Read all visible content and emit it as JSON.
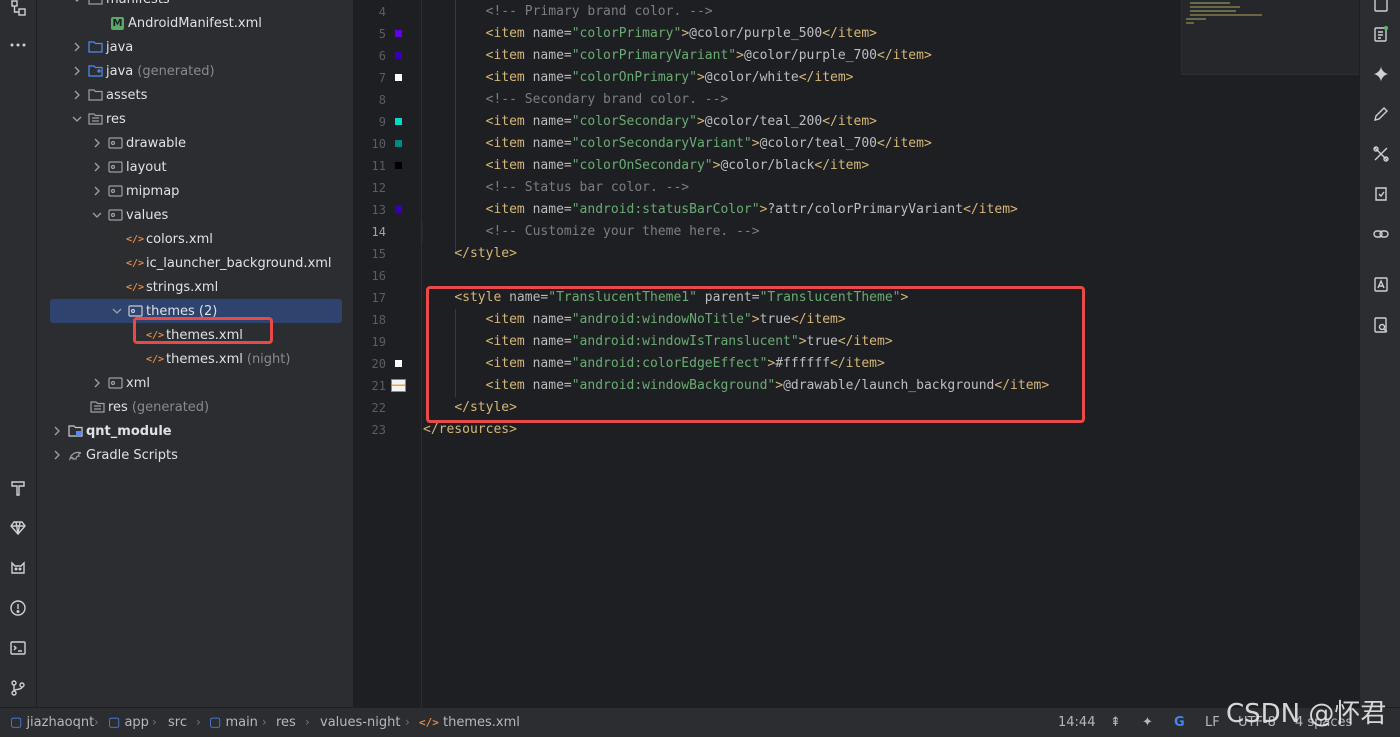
{
  "project_tree": {
    "items": [
      {
        "label": "manifests",
        "hint": ""
      },
      {
        "label": "AndroidManifest.xml",
        "hint": ""
      },
      {
        "label": "java",
        "hint": ""
      },
      {
        "label": "java",
        "hint": "(generated)"
      },
      {
        "label": "assets",
        "hint": ""
      },
      {
        "label": "res",
        "hint": ""
      },
      {
        "label": "drawable",
        "hint": ""
      },
      {
        "label": "layout",
        "hint": ""
      },
      {
        "label": "mipmap",
        "hint": ""
      },
      {
        "label": "values",
        "hint": ""
      },
      {
        "label": "colors.xml",
        "hint": ""
      },
      {
        "label": "ic_launcher_background.xml",
        "hint": ""
      },
      {
        "label": "strings.xml",
        "hint": ""
      },
      {
        "label": "themes (2)",
        "hint": ""
      },
      {
        "label": "themes.xml",
        "hint": ""
      },
      {
        "label": "themes.xml",
        "hint": "(night)"
      },
      {
        "label": "xml",
        "hint": ""
      },
      {
        "label": "res",
        "hint": "(generated)"
      },
      {
        "label": "qnt_module",
        "hint": ""
      },
      {
        "label": "Gradle Scripts",
        "hint": ""
      }
    ]
  },
  "editor": {
    "current_line": "14",
    "lines": [
      {
        "n": "4",
        "indent": "        ",
        "parts": [
          {
            "t": "com",
            "s": "<!-- Primary brand color. -->"
          }
        ]
      },
      {
        "n": "5",
        "indent": "        ",
        "parts": [
          {
            "t": "tag",
            "s": "<item "
          },
          {
            "t": "attr",
            "s": "name="
          },
          {
            "t": "val",
            "s": "\"colorPrimary\""
          },
          {
            "t": "tag",
            "s": ">"
          },
          {
            "t": "txt",
            "s": "@color/purple_500"
          },
          {
            "t": "tag",
            "s": "</item>"
          }
        ]
      },
      {
        "n": "6",
        "indent": "        ",
        "parts": [
          {
            "t": "tag",
            "s": "<item "
          },
          {
            "t": "attr",
            "s": "name="
          },
          {
            "t": "val",
            "s": "\"colorPrimaryVariant\""
          },
          {
            "t": "tag",
            "s": ">"
          },
          {
            "t": "txt",
            "s": "@color/purple_700"
          },
          {
            "t": "tag",
            "s": "</item>"
          }
        ]
      },
      {
        "n": "7",
        "indent": "        ",
        "parts": [
          {
            "t": "tag",
            "s": "<item "
          },
          {
            "t": "attr",
            "s": "name="
          },
          {
            "t": "val",
            "s": "\"colorOnPrimary\""
          },
          {
            "t": "tag",
            "s": ">"
          },
          {
            "t": "txt",
            "s": "@color/white"
          },
          {
            "t": "tag",
            "s": "</item>"
          }
        ]
      },
      {
        "n": "8",
        "indent": "        ",
        "parts": [
          {
            "t": "com",
            "s": "<!-- Secondary brand color. -->"
          }
        ]
      },
      {
        "n": "9",
        "indent": "        ",
        "parts": [
          {
            "t": "tag",
            "s": "<item "
          },
          {
            "t": "attr",
            "s": "name="
          },
          {
            "t": "val",
            "s": "\"colorSecondary\""
          },
          {
            "t": "tag",
            "s": ">"
          },
          {
            "t": "txt",
            "s": "@color/teal_200"
          },
          {
            "t": "tag",
            "s": "</item>"
          }
        ]
      },
      {
        "n": "10",
        "indent": "        ",
        "parts": [
          {
            "t": "tag",
            "s": "<item "
          },
          {
            "t": "attr",
            "s": "name="
          },
          {
            "t": "val",
            "s": "\"colorSecondaryVariant\""
          },
          {
            "t": "tag",
            "s": ">"
          },
          {
            "t": "txt",
            "s": "@color/teal_700"
          },
          {
            "t": "tag",
            "s": "</item>"
          }
        ]
      },
      {
        "n": "11",
        "indent": "        ",
        "parts": [
          {
            "t": "tag",
            "s": "<item "
          },
          {
            "t": "attr",
            "s": "name="
          },
          {
            "t": "val",
            "s": "\"colorOnSecondary\""
          },
          {
            "t": "tag",
            "s": ">"
          },
          {
            "t": "txt",
            "s": "@color/black"
          },
          {
            "t": "tag",
            "s": "</item>"
          }
        ]
      },
      {
        "n": "12",
        "indent": "        ",
        "parts": [
          {
            "t": "com",
            "s": "<!-- Status bar color. -->"
          }
        ]
      },
      {
        "n": "13",
        "indent": "        ",
        "parts": [
          {
            "t": "tag",
            "s": "<item "
          },
          {
            "t": "attr",
            "s": "name="
          },
          {
            "t": "val",
            "s": "\"android:statusBarColor\""
          },
          {
            "t": "tag",
            "s": ">"
          },
          {
            "t": "txt",
            "s": "?attr/colorPrimaryVariant"
          },
          {
            "t": "tag",
            "s": "</item>"
          }
        ]
      },
      {
        "n": "14",
        "indent": "        ",
        "parts": [
          {
            "t": "com",
            "s": "<!-- Customize your theme here. -->"
          }
        ]
      },
      {
        "n": "15",
        "indent": "    ",
        "parts": [
          {
            "t": "tag",
            "s": "</style>"
          }
        ]
      },
      {
        "n": "16",
        "indent": "",
        "parts": []
      },
      {
        "n": "17",
        "indent": "    ",
        "parts": [
          {
            "t": "tag",
            "s": "<style "
          },
          {
            "t": "attr",
            "s": "name="
          },
          {
            "t": "val",
            "s": "\"TranslucentTheme1\""
          },
          {
            "t": "attr",
            "s": " parent="
          },
          {
            "t": "val",
            "s": "\"TranslucentTheme\""
          },
          {
            "t": "tag",
            "s": ">"
          }
        ]
      },
      {
        "n": "18",
        "indent": "        ",
        "parts": [
          {
            "t": "tag",
            "s": "<item "
          },
          {
            "t": "attr",
            "s": "name="
          },
          {
            "t": "val",
            "s": "\"android:windowNoTitle\""
          },
          {
            "t": "tag",
            "s": ">"
          },
          {
            "t": "txt",
            "s": "true"
          },
          {
            "t": "tag",
            "s": "</item>"
          }
        ]
      },
      {
        "n": "19",
        "indent": "        ",
        "parts": [
          {
            "t": "tag",
            "s": "<item "
          },
          {
            "t": "attr",
            "s": "name="
          },
          {
            "t": "val",
            "s": "\"android:windowIsTranslucent\""
          },
          {
            "t": "tag",
            "s": ">"
          },
          {
            "t": "txt",
            "s": "true"
          },
          {
            "t": "tag",
            "s": "</item>"
          }
        ]
      },
      {
        "n": "20",
        "indent": "        ",
        "parts": [
          {
            "t": "tag",
            "s": "<item "
          },
          {
            "t": "attr",
            "s": "name="
          },
          {
            "t": "val",
            "s": "\"android:colorEdgeEffect\""
          },
          {
            "t": "tag",
            "s": ">"
          },
          {
            "t": "txt",
            "s": "#ffffff"
          },
          {
            "t": "tag",
            "s": "</item>"
          }
        ]
      },
      {
        "n": "21",
        "indent": "        ",
        "parts": [
          {
            "t": "tag",
            "s": "<item "
          },
          {
            "t": "attr",
            "s": "name="
          },
          {
            "t": "val",
            "s": "\"android:windowBackground\""
          },
          {
            "t": "tag",
            "s": ">"
          },
          {
            "t": "txt",
            "s": "@drawable/launch_background"
          },
          {
            "t": "tag",
            "s": "</item>"
          }
        ]
      },
      {
        "n": "22",
        "indent": "    ",
        "parts": [
          {
            "t": "tag",
            "s": "</style>"
          }
        ]
      },
      {
        "n": "23",
        "indent": "",
        "parts": [
          {
            "t": "tag",
            "s": "</resources>"
          }
        ]
      }
    ],
    "swatches": {
      "5": "#6200ee",
      "6": "#3700b3",
      "7": "#ffffff",
      "9": "#03dac5",
      "10": "#018786",
      "11": "#000000",
      "13": "#3700b3",
      "20": "#ffffff"
    }
  },
  "statusbar": {
    "breadcrumbs": [
      "jiazhaoqnt",
      "app",
      "src",
      "main",
      "res",
      "values-night",
      "themes.xml"
    ],
    "position": "14:44",
    "line_separator": "LF",
    "encoding": "UTF-8",
    "indent": "4 spaces"
  },
  "watermark": "CSDN @怀君",
  "colors": {
    "highlight_box": "#e84a4a",
    "selection": "#2e436e",
    "tag": "#d5b778",
    "string": "#6aab73",
    "comment": "#7a7e85"
  }
}
